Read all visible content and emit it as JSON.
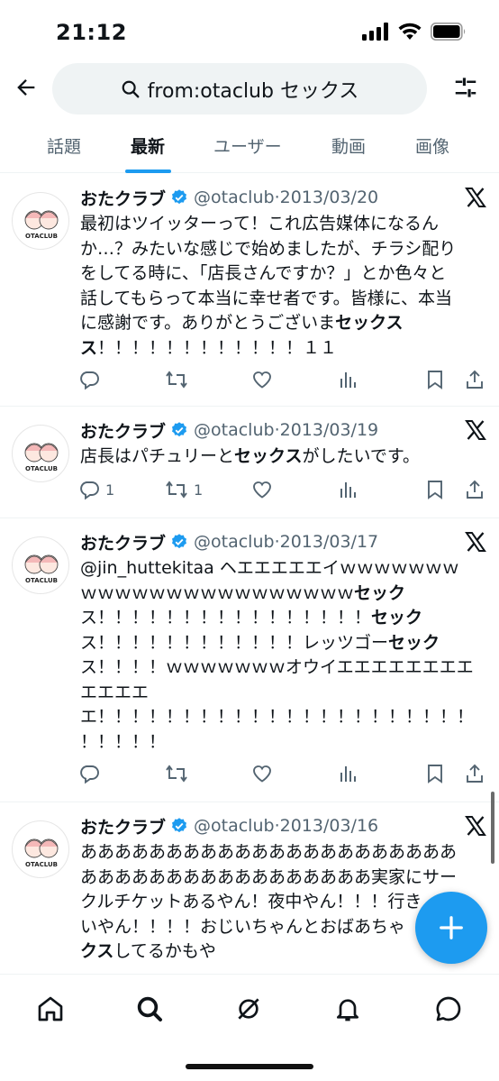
{
  "status_bar": {
    "time": "21:12"
  },
  "search": {
    "query": "from:otaclub セックス"
  },
  "tabs": [
    {
      "label": "話題"
    },
    {
      "label": "最新"
    },
    {
      "label": "ユーザー"
    },
    {
      "label": "動画"
    },
    {
      "label": "画像"
    }
  ],
  "tweets": [
    {
      "name": "おたクラブ",
      "handle": "@otaclub",
      "sep": "·",
      "date": "2013/03/20",
      "text_lines": [
        "最初はツイッターって！これ広告媒体になるん",
        "か…？みたいな感じで始めましたが、チラシ配り",
        "をしてる時に、「店長さんですか？」とか色々と",
        "話してもらって本当に幸せ者です。皆様に、本当",
        "に感謝です。ありがとうございま",
        "セックス",
        "ス！！！！！！！！！！！！１１"
      ],
      "replies": "",
      "retweets": ""
    },
    {
      "name": "おたクラブ",
      "handle": "@otaclub",
      "sep": "·",
      "date": "2013/03/19",
      "text_lines": [
        "店長はパチュリーと",
        "セックス",
        "がしたいです。"
      ],
      "replies": "1",
      "retweets": "1"
    },
    {
      "name": "おたクラブ",
      "handle": "@otaclub",
      "sep": "·",
      "date": "2013/03/17",
      "text_lines": [
        "@jin_huttekitaa ヘエエエエエイｗｗｗｗｗｗｗ",
        "ｗｗｗｗｗｗｗｗｗｗｗｗｗｗｗｗ",
        "セック",
        "ス！！！！！！！！！！！！！！！！",
        "セック",
        "ス！！！！！！！！！！！！レッツゴー",
        "セック",
        "ス！！！！ｗｗｗｗｗｗｗオウイエエエエエエエエ",
        "エエエエ",
        "エ！！！！！！！！！！！！！！！！！！！！！！",
        "！！！！！"
      ],
      "replies": "",
      "retweets": ""
    },
    {
      "name": "おたクラブ",
      "handle": "@otaclub",
      "sep": "·",
      "date": "2013/03/16",
      "text_lines": [
        "ああああああああああああああああああああああ",
        "あああああああああああああああああ実家にサー",
        "クルチケットあるやん！夜中やん！！！行き",
        "いやん！！！！おじいちゃんとおばあちゃ",
        "クス",
        "してるかもや"
      ],
      "replies": "",
      "retweets": ""
    }
  ],
  "avatar_text": {
    "top": "TOTAL PRINT SHOP",
    "bottom": "OTACLUB"
  },
  "icons": {
    "back": "arrow-left-icon",
    "search": "search-icon",
    "filter": "sliders-icon",
    "verified": "verified-badge-icon",
    "x": "x-logo-icon",
    "compose": "plus-icon",
    "nav": [
      "home-icon",
      "explore-icon",
      "grok-icon",
      "notifications-icon",
      "messages-icon"
    ]
  },
  "colors": {
    "accent": "#1d9bf0",
    "text": "#0f1419",
    "muted": "#536471",
    "search_bg": "#eff3f4"
  }
}
